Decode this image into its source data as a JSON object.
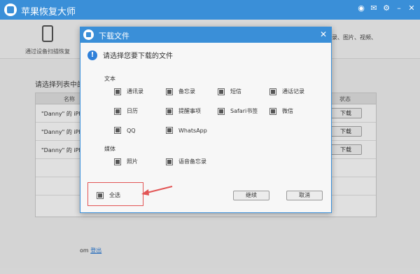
{
  "app": {
    "title": "苹果恢复大师",
    "icons": [
      "weibo-icon",
      "message-icon",
      "settings-icon",
      "minimize-icon",
      "close-icon"
    ]
  },
  "toolbar": {
    "mode_label": "通过设备扫描恢复",
    "right_text": "讯录、图片、视频、"
  },
  "content": {
    "prompt": "请选择列表中的",
    "table": {
      "headers": {
        "name": "名称",
        "status": "状态"
      },
      "rows": [
        {
          "name": "\"Danny\" 的 iPh",
          "button": "下载"
        },
        {
          "name": "\"Danny\" 的 iPh",
          "button": "下载"
        },
        {
          "name": "\"Danny\" 的 iPh",
          "button": "下载"
        }
      ]
    },
    "footer": {
      "suffix": "om",
      "logout": "登出"
    }
  },
  "dialog": {
    "title": "下载文件",
    "prompt": "请选择您要下载的文件",
    "sections": [
      {
        "label": "文本",
        "items": [
          {
            "label": "通讯录",
            "checked": true
          },
          {
            "label": "备忘录",
            "checked": true
          },
          {
            "label": "短信",
            "checked": true
          },
          {
            "label": "通话记录",
            "checked": true
          },
          {
            "label": "日历",
            "checked": true
          },
          {
            "label": "提醒事项",
            "checked": true
          },
          {
            "label": "Safari书签",
            "checked": true
          },
          {
            "label": "微信",
            "checked": true
          },
          {
            "label": "QQ",
            "checked": true
          },
          {
            "label": "WhatsApp",
            "checked": true
          }
        ]
      },
      {
        "label": "媒体",
        "items": [
          {
            "label": "照片",
            "checked": true
          },
          {
            "label": "语音备忘录",
            "checked": true
          }
        ]
      }
    ],
    "select_all": {
      "label": "全选",
      "checked": true
    },
    "buttons": {
      "continue": "继续",
      "cancel": "取消"
    }
  },
  "colors": {
    "accent": "#3a8fd8",
    "annotation": "#e25555"
  }
}
